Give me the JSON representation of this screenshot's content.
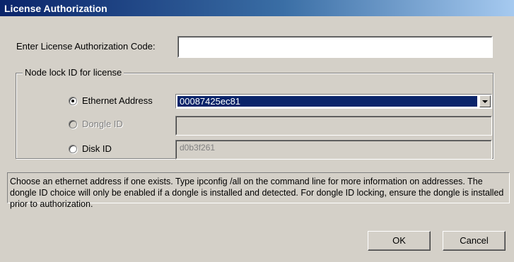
{
  "window": {
    "title": "License Authorization"
  },
  "auth_code": {
    "label": "Enter License Authorization Code:",
    "value": ""
  },
  "node_lock": {
    "group_label": "Node lock ID for license",
    "options": [
      {
        "label": "Ethernet Address",
        "selected": true,
        "enabled": true,
        "value": "00087425ec81",
        "control": "dropdown"
      },
      {
        "label": "Dongle ID",
        "selected": false,
        "enabled": false,
        "value": "",
        "control": "text"
      },
      {
        "label": "Disk ID",
        "selected": false,
        "enabled": true,
        "value": "d0b3f261",
        "control": "text-readonly"
      }
    ]
  },
  "info_text": "Choose an ethernet address if one exists. Type ipconfig /all on the command line for more information on addresses. The dongle ID choice will only be enabled if a dongle is installed and detected. For dongle ID locking, ensure the dongle is installed prior to authorization.",
  "buttons": {
    "ok": "OK",
    "cancel": "Cancel"
  },
  "colors": {
    "dialog_bg": "#d4d0c8",
    "title_start": "#0a246a",
    "title_end": "#a6caf0",
    "selection": "#0a246a"
  }
}
